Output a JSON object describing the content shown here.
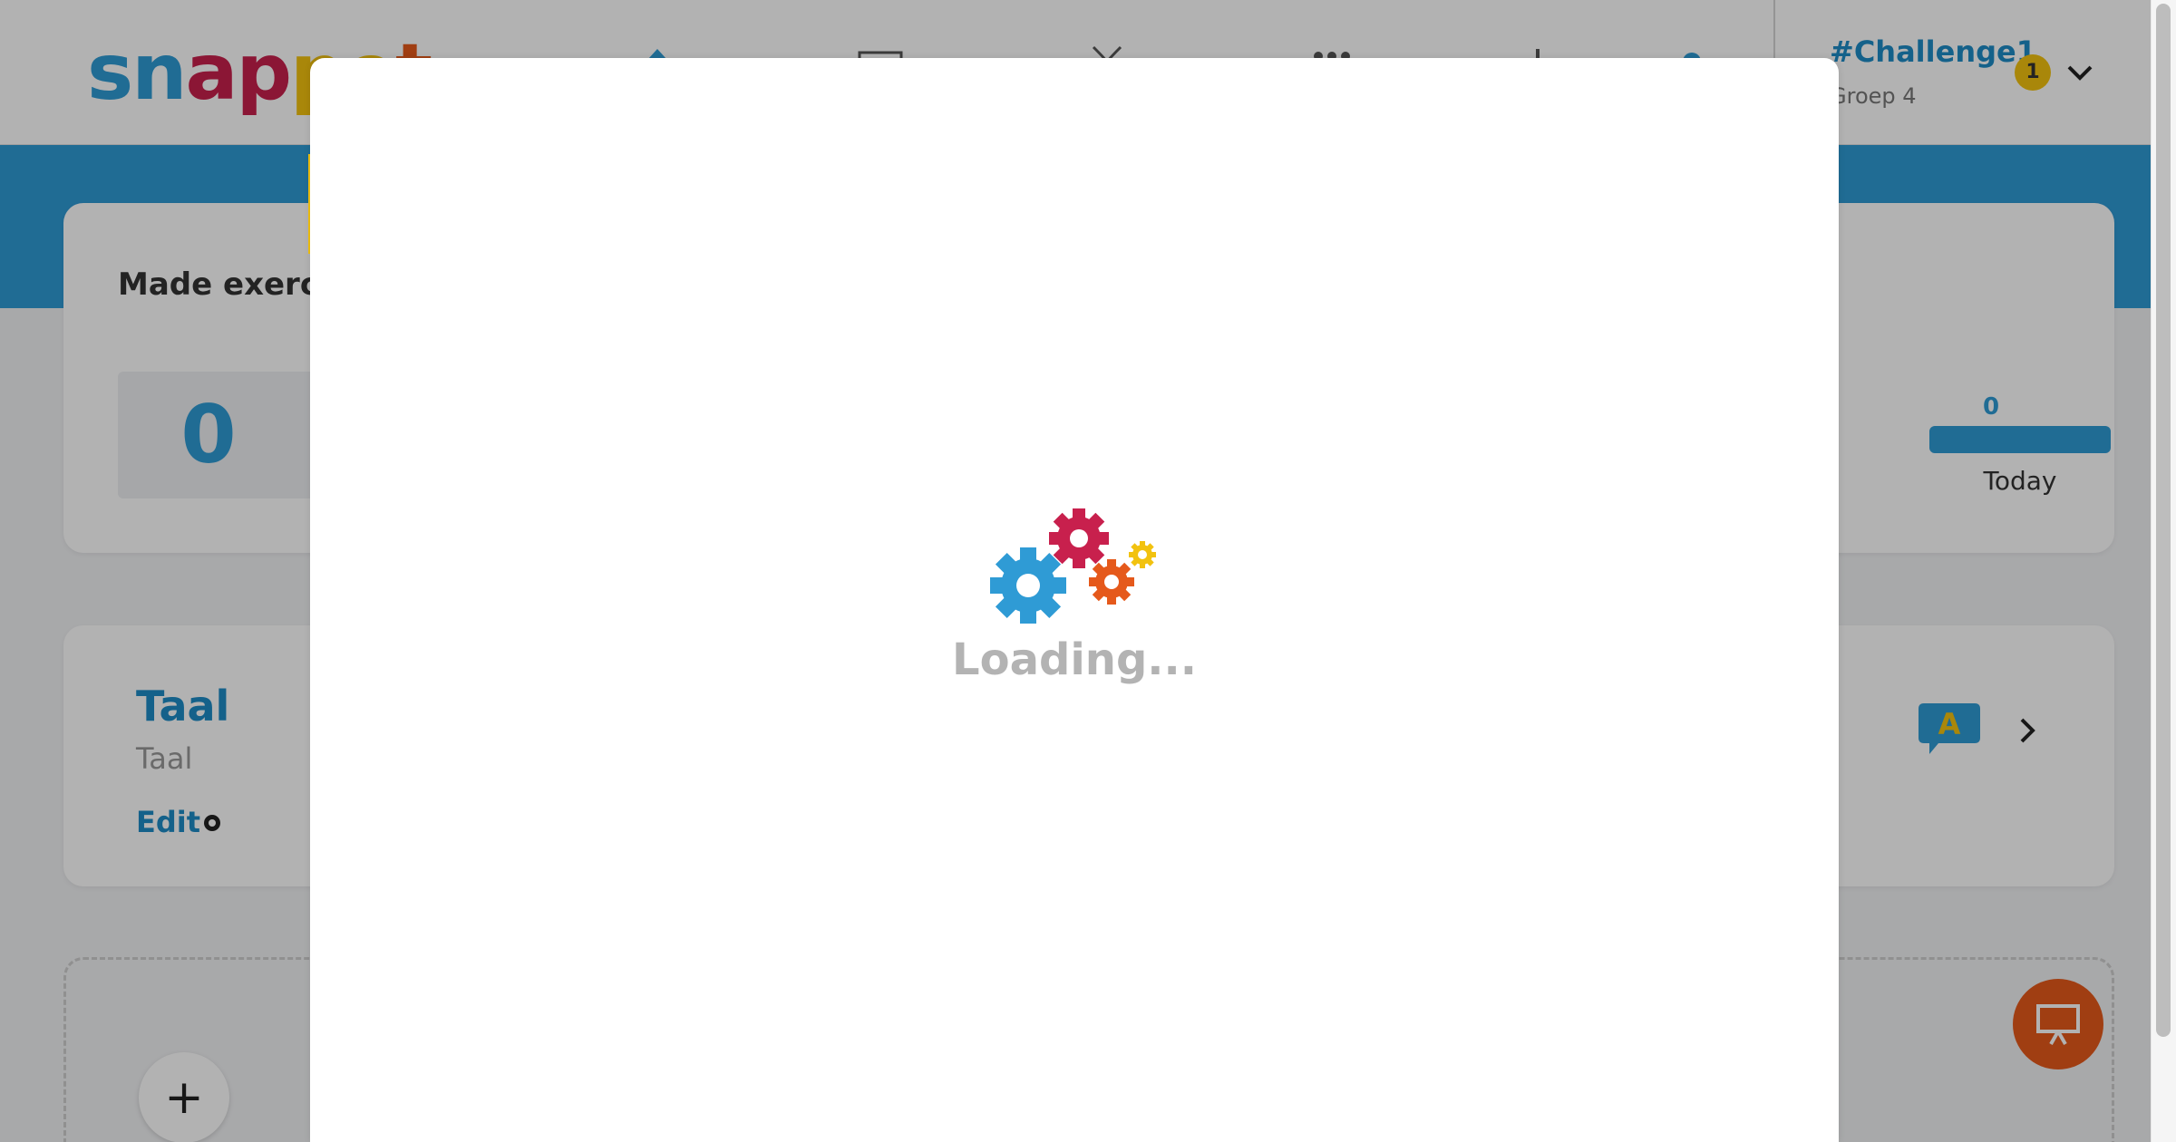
{
  "app": {
    "logo_text": "snappet"
  },
  "header": {
    "nav_icons": [
      "home-icon",
      "screen-icon",
      "gift-icon",
      "students-icon",
      "chart-icon",
      "help-icon"
    ],
    "challenge_title": "#Challenge1",
    "group_label": "Groep 4",
    "notification_count": "1"
  },
  "stats": {
    "title": "Made exercis",
    "count": "0",
    "bar_value": "0",
    "bar_label": "Today"
  },
  "subject": {
    "title": "Taal",
    "subtitle": "Taal",
    "edit_label": "Edit",
    "badge_letter": "A"
  },
  "add": {
    "plus": "+"
  },
  "modal": {
    "loading_text": "Loading..."
  },
  "colors": {
    "primary_blue": "#2f9bd5",
    "accent_orange": "#e5591b",
    "accent_yellow": "#f2c20f",
    "accent_red": "#c8204d"
  }
}
